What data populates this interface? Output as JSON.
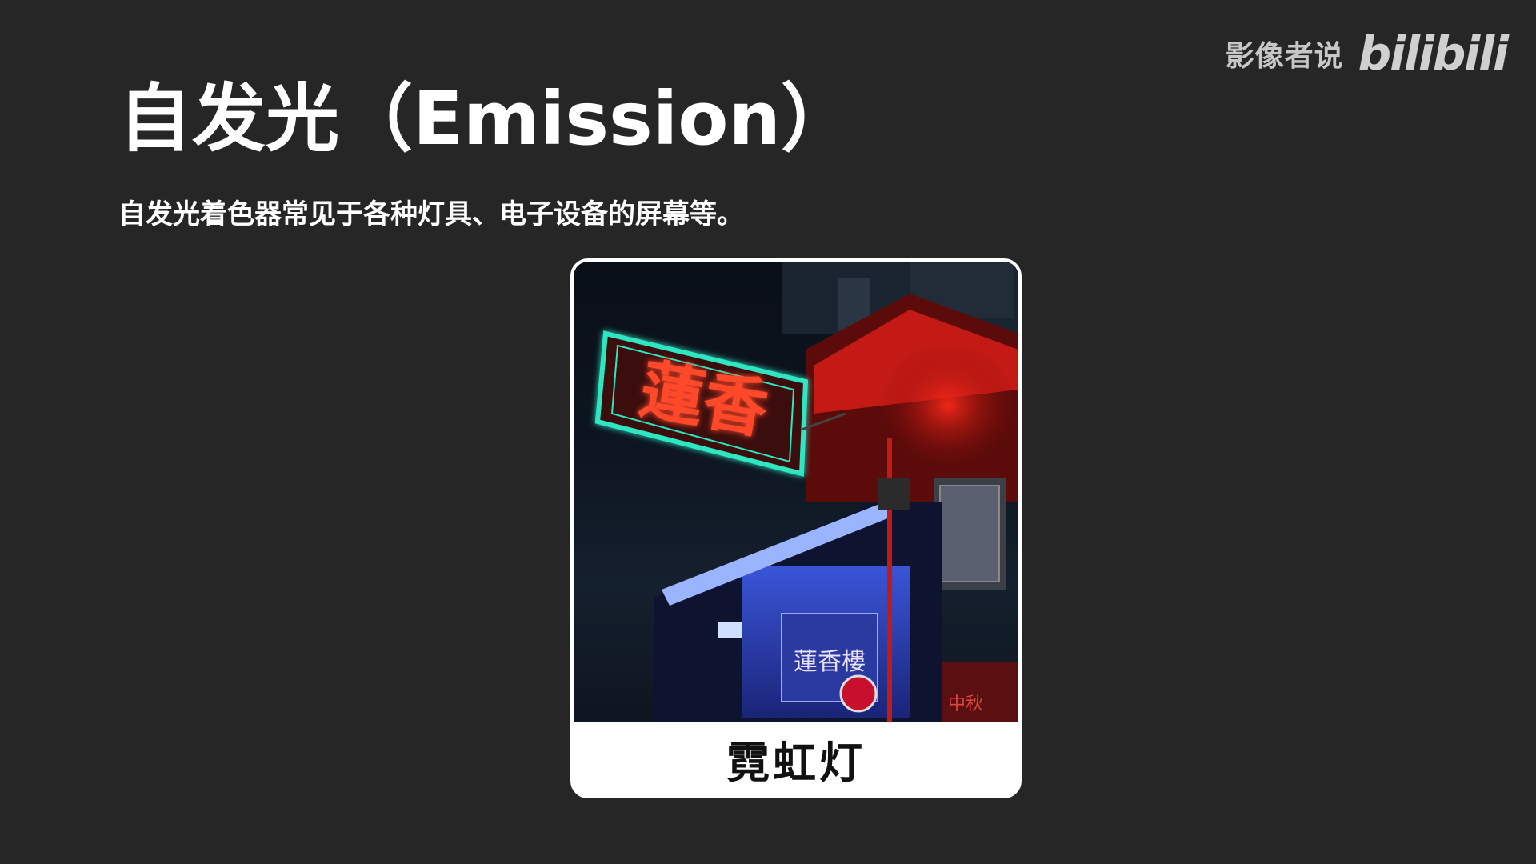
{
  "watermark": {
    "channel": "影像者说",
    "logo_text": "bilibili"
  },
  "slide": {
    "title": "自发光（Emission）",
    "subtitle": "自发光着色器常见于各种灯具、电子设备的屏幕等。"
  },
  "card": {
    "caption": "霓虹灯",
    "photo": {
      "sign_text": "蓮香",
      "shop_text": "蓮香樓",
      "banner_text": "中秋",
      "colors": {
        "neon_green": "#2ee6c2",
        "neon_red": "#ff3a22",
        "building_red": "#c41a16",
        "shop_blue": "#4d6cff"
      }
    }
  }
}
